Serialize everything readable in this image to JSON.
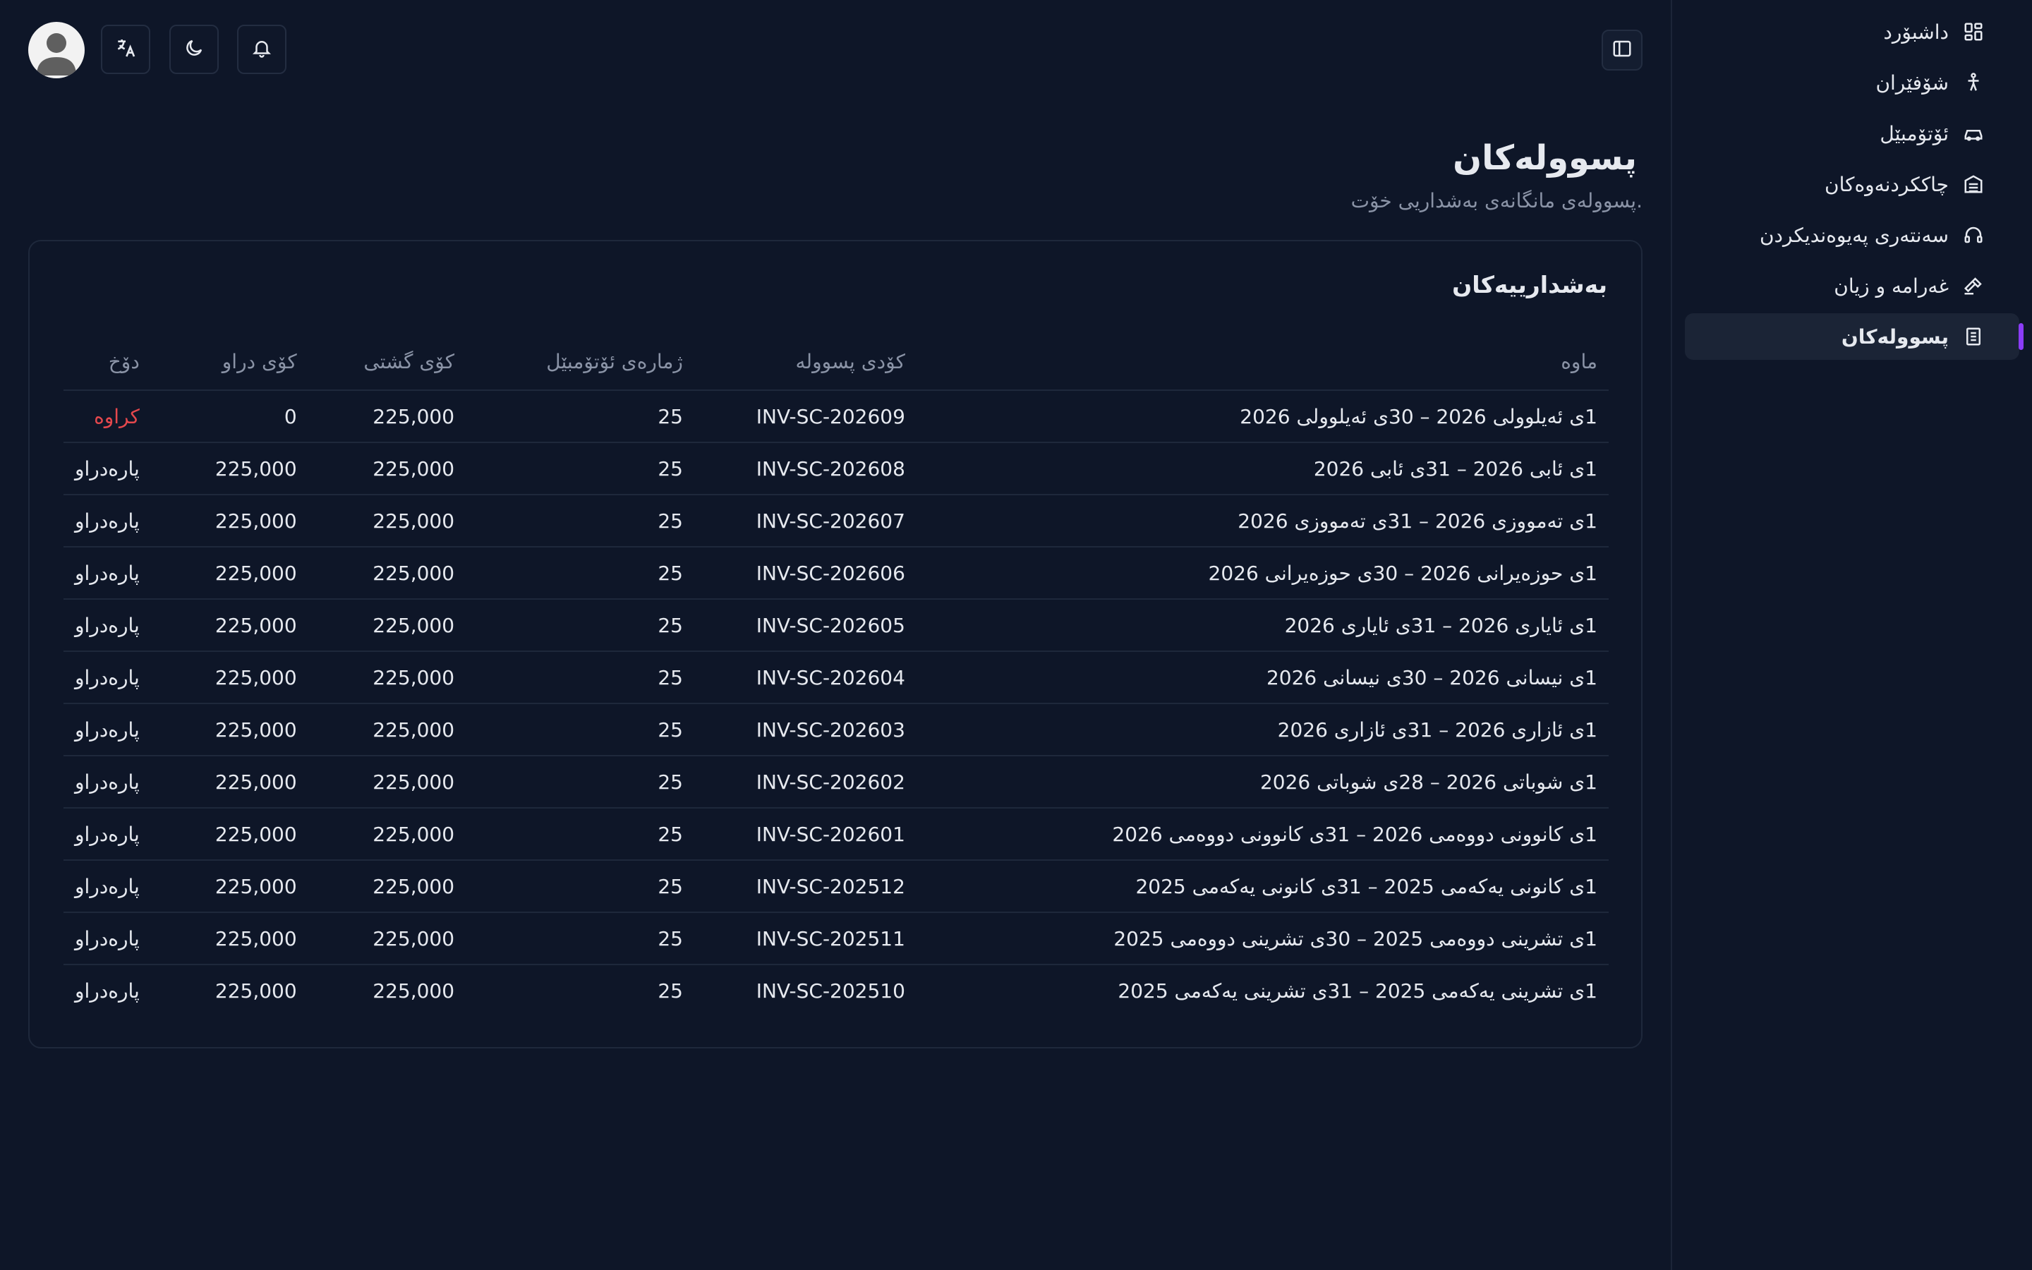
{
  "sidebar": {
    "items": [
      {
        "label": "داشبۆرد",
        "icon": "dashboard-icon",
        "active": false
      },
      {
        "label": "شۆفێران",
        "icon": "driver-icon",
        "active": false
      },
      {
        "label": "ئۆتۆمبێل",
        "icon": "car-icon",
        "active": false
      },
      {
        "label": "چاککردنەوەکان",
        "icon": "maintenance-icon",
        "active": false
      },
      {
        "label": "سەنتەری پەیوەندیکردن",
        "icon": "headset-icon",
        "active": false
      },
      {
        "label": "غەرامە و زیان",
        "icon": "hammer-icon",
        "active": false
      },
      {
        "label": "پسوولەکان",
        "icon": "invoice-icon",
        "active": true
      }
    ]
  },
  "header": {
    "title": "پسوولەکان",
    "subtitle": "پسوولەی مانگانەی بەشداریی خۆت."
  },
  "topbar": {
    "icons": [
      "avatar",
      "translate-icon",
      "moon-icon",
      "bell-icon",
      "sidebar-toggle-icon"
    ]
  },
  "card": {
    "title": "بەشدارییەکان",
    "columns": [
      "ماوە",
      "کۆدی پسوولە",
      "ژمارەی ئۆتۆمبێل",
      "کۆی گشتی",
      "کۆی دراو",
      "دۆخ"
    ],
    "rows": [
      {
        "period": "1ی ئەیلوولی 2026 – 30ی ئەیلوولی 2026",
        "code": "INV-SC-202609",
        "cars": "25",
        "total": "225,000",
        "paid": "0",
        "status": "کراوە",
        "unpaid": true
      },
      {
        "period": "1ی ئابی 2026 – 31ی ئابی 2026",
        "code": "INV-SC-202608",
        "cars": "25",
        "total": "225,000",
        "paid": "225,000",
        "status": "پارەدراو",
        "unpaid": false
      },
      {
        "period": "1ی تەمووزی 2026 – 31ی تەمووزی 2026",
        "code": "INV-SC-202607",
        "cars": "25",
        "total": "225,000",
        "paid": "225,000",
        "status": "پارەدراو",
        "unpaid": false
      },
      {
        "period": "1ی حوزەیرانی 2026 – 30ی حوزەیرانی 2026",
        "code": "INV-SC-202606",
        "cars": "25",
        "total": "225,000",
        "paid": "225,000",
        "status": "پارەدراو",
        "unpaid": false
      },
      {
        "period": "1ی ئایاری 2026 – 31ی ئایاری 2026",
        "code": "INV-SC-202605",
        "cars": "25",
        "total": "225,000",
        "paid": "225,000",
        "status": "پارەدراو",
        "unpaid": false
      },
      {
        "period": "1ی نیسانی 2026 – 30ی نیسانی 2026",
        "code": "INV-SC-202604",
        "cars": "25",
        "total": "225,000",
        "paid": "225,000",
        "status": "پارەدراو",
        "unpaid": false
      },
      {
        "period": "1ی ئازاری 2026 – 31ی ئازاری 2026",
        "code": "INV-SC-202603",
        "cars": "25",
        "total": "225,000",
        "paid": "225,000",
        "status": "پارەدراو",
        "unpaid": false
      },
      {
        "period": "1ی شوباتی 2026 – 28ی شوباتی 2026",
        "code": "INV-SC-202602",
        "cars": "25",
        "total": "225,000",
        "paid": "225,000",
        "status": "پارەدراو",
        "unpaid": false
      },
      {
        "period": "1ی کانوونی دووەمی 2026 – 31ی کانوونی دووەمی 2026",
        "code": "INV-SC-202601",
        "cars": "25",
        "total": "225,000",
        "paid": "225,000",
        "status": "پارەدراو",
        "unpaid": false
      },
      {
        "period": "1ی کانونی یەکەمی 2025 – 31ی کانونی یەکەمی 2025",
        "code": "INV-SC-202512",
        "cars": "25",
        "total": "225,000",
        "paid": "225,000",
        "status": "پارەدراو",
        "unpaid": false
      },
      {
        "period": "1ی تشرینی دووەمی 2025 – 30ی تشرینی دووەمی 2025",
        "code": "INV-SC-202511",
        "cars": "25",
        "total": "225,000",
        "paid": "225,000",
        "status": "پارەدراو",
        "unpaid": false
      },
      {
        "period": "1ی تشرینی یەکەمی 2025 – 31ی تشرینی یەکەمی 2025",
        "code": "INV-SC-202510",
        "cars": "25",
        "total": "225,000",
        "paid": "225,000",
        "status": "پارەدراو",
        "unpaid": false
      }
    ]
  },
  "colors": {
    "background": "#0e1628",
    "accent": "#8b3cf7",
    "unpaid": "#e5484d",
    "muted": "#8a93a6"
  }
}
